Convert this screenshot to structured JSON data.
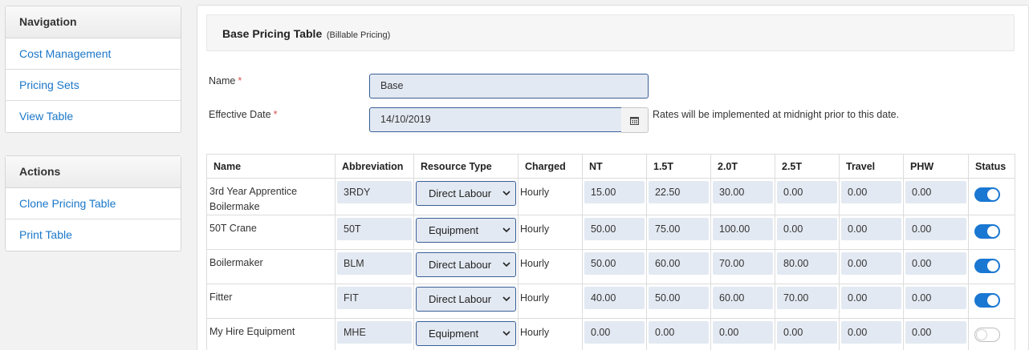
{
  "sidebar": {
    "navigation": {
      "title": "Navigation",
      "items": [
        {
          "label": "Cost Management"
        },
        {
          "label": "Pricing Sets"
        },
        {
          "label": "View Table"
        }
      ]
    },
    "actions": {
      "title": "Actions",
      "items": [
        {
          "label": "Clone Pricing Table"
        },
        {
          "label": "Print Table"
        }
      ]
    }
  },
  "header": {
    "title": "Base Pricing Table",
    "subtitle": "(Billable Pricing)"
  },
  "form": {
    "name_label": "Name",
    "name_value": "Base",
    "date_label": "Effective Date",
    "date_value": "14/10/2019",
    "date_hint": "Rates will be implemented at midnight prior to this date.",
    "required_mark": "*"
  },
  "table": {
    "columns": [
      "Name",
      "Abbreviation",
      "Resource Type",
      "Charged",
      "NT",
      "1.5T",
      "2.0T",
      "2.5T",
      "Travel",
      "PHW",
      "Status"
    ],
    "rows": [
      {
        "name": "3rd Year Apprentice Boilermake",
        "abbr": "3RDY",
        "type": "Direct Labour",
        "charged": "Hourly",
        "nt": "15.00",
        "t15": "22.50",
        "t20": "30.00",
        "t25": "0.00",
        "travel": "0.00",
        "phw": "0.00",
        "status": "on"
      },
      {
        "name": "50T Crane",
        "abbr": "50T",
        "type": "Equipment",
        "charged": "Hourly",
        "nt": "50.00",
        "t15": "75.00",
        "t20": "100.00",
        "t25": "0.00",
        "travel": "0.00",
        "phw": "0.00",
        "status": "on"
      },
      {
        "name": "Boilermaker",
        "abbr": "BLM",
        "type": "Direct Labour",
        "charged": "Hourly",
        "nt": "50.00",
        "t15": "60.00",
        "t20": "70.00",
        "t25": "80.00",
        "travel": "0.00",
        "phw": "0.00",
        "status": "on"
      },
      {
        "name": "Fitter",
        "abbr": "FIT",
        "type": "Direct Labour",
        "charged": "Hourly",
        "nt": "40.00",
        "t15": "50.00",
        "t20": "60.00",
        "t25": "70.00",
        "travel": "0.00",
        "phw": "0.00",
        "status": "on"
      },
      {
        "name": "My Hire Equipment",
        "abbr": "MHE",
        "type": "Equipment",
        "charged": "Hourly",
        "nt": "0.00",
        "t15": "0.00",
        "t20": "0.00",
        "t25": "0.00",
        "travel": "0.00",
        "phw": "0.00",
        "status": "off"
      }
    ]
  },
  "colors": {
    "link": "#1a77c9",
    "accent": "#1a77d2",
    "input_bg": "#e3e9f2",
    "input_border": "#3a5f97",
    "required": "#d9534f"
  },
  "icons": {
    "calendar": "calendar-icon",
    "select_arrow": "chevron-down-icon"
  }
}
